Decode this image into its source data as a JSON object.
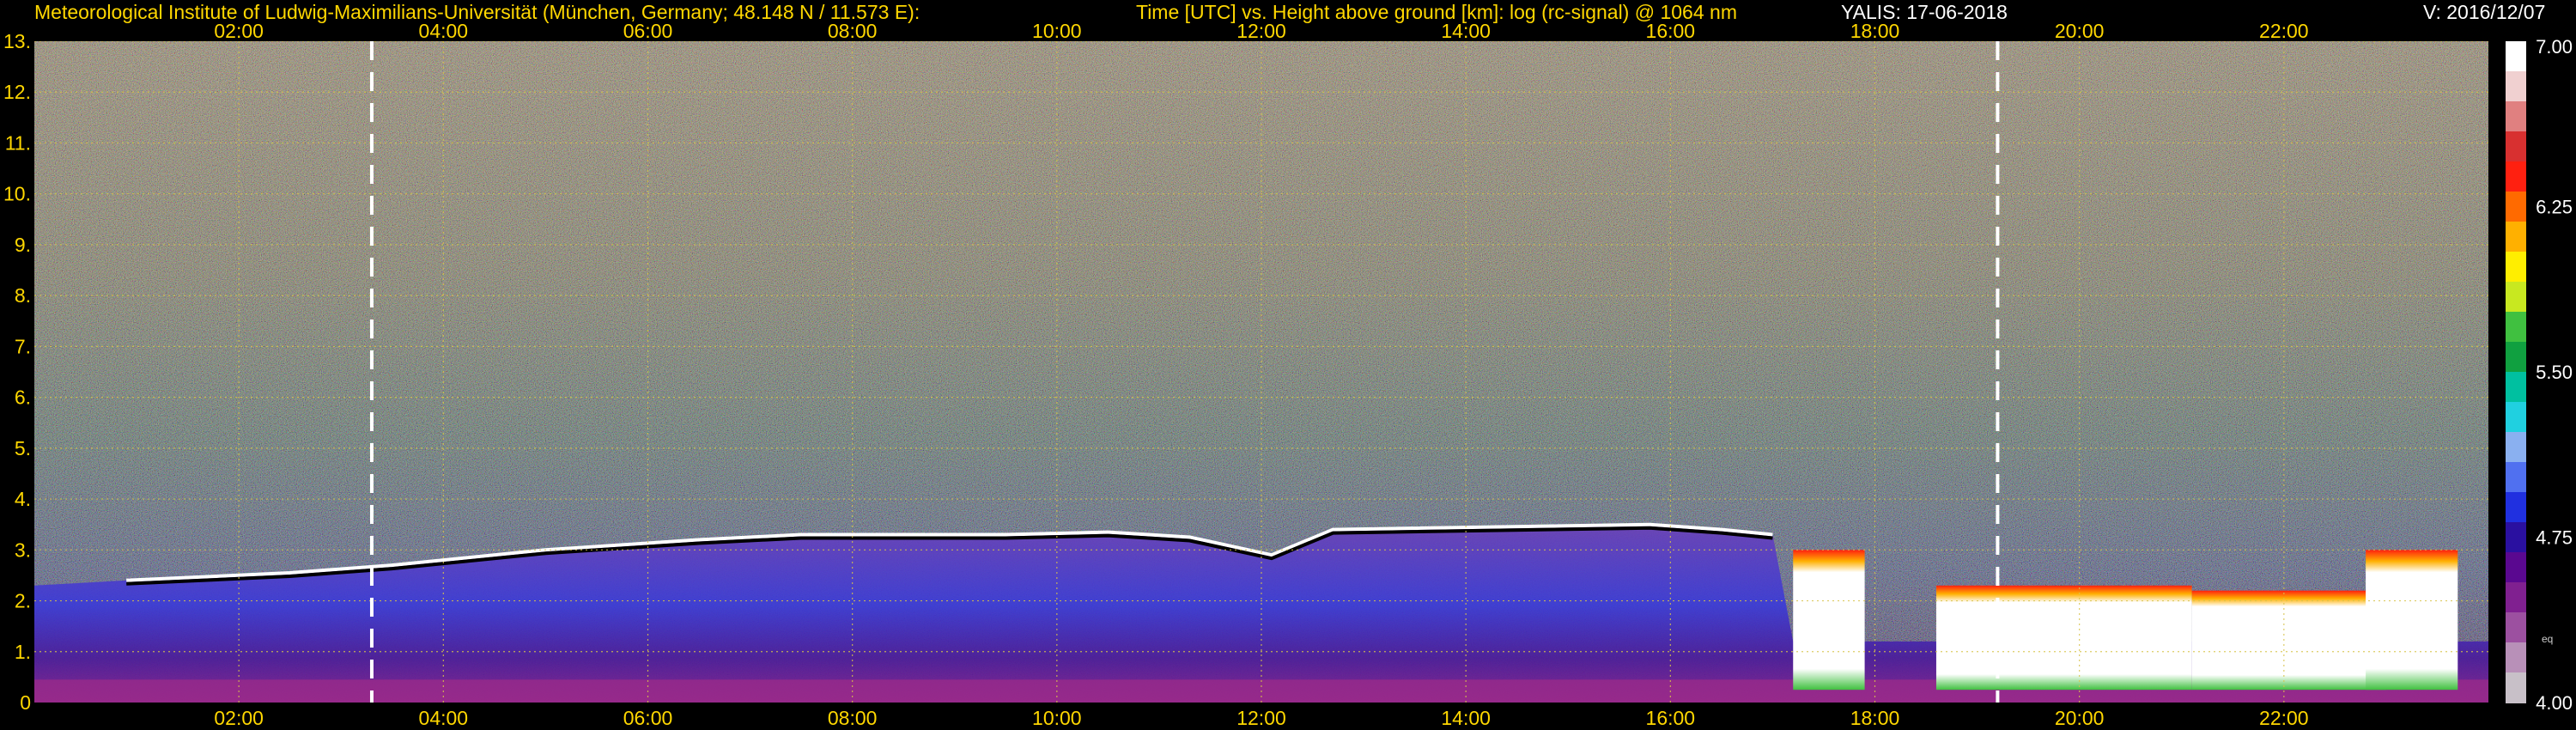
{
  "header": {
    "institute": "Meteorological Institute of Ludwig-Maximilians-Universität (München, Germany; 48.148 N / 11.573 E):",
    "axes_title": "Time [UTC] vs. Height above ground [km]: log (rc-signal) @ 1064 nm",
    "station_date": "YALIS: 17-06-2018",
    "version": "V: 2016/12/07"
  },
  "chart_data": {
    "type": "heatmap",
    "title": "Time [UTC] vs. Height above ground [km]: log (rc-signal) @ 1064 nm",
    "xlabel": "Time [UTC]",
    "ylabel": "Height above ground [km]",
    "x_tick_labels": [
      "02:00",
      "04:00",
      "06:00",
      "08:00",
      "10:00",
      "12:00",
      "14:00",
      "16:00",
      "18:00",
      "20:00",
      "22:00"
    ],
    "x_ticks_hours": [
      2,
      4,
      6,
      8,
      10,
      12,
      14,
      16,
      18,
      20,
      22
    ],
    "xlim_hours": [
      0.0,
      24.0
    ],
    "y_tick_labels": [
      "0",
      "1.",
      "2.",
      "3.",
      "4.",
      "5.",
      "6.",
      "7.",
      "8.",
      "9.",
      "10.",
      "11.",
      "12.",
      "13."
    ],
    "y_ticks_km": [
      0,
      1,
      2,
      3,
      4,
      5,
      6,
      7,
      8,
      9,
      10,
      11,
      12,
      13
    ],
    "ylim_km": [
      0,
      13
    ],
    "grid": true,
    "dashed_markers_hours": [
      3.3,
      19.2
    ],
    "colorbar": {
      "range": [
        4.0,
        7.0
      ],
      "tick_labels": [
        "7.00",
        "6.25",
        "5.50",
        "4.75",
        "4.00"
      ],
      "tick_values": [
        7.0,
        6.25,
        5.5,
        4.75,
        4.0
      ],
      "small_label": "eq",
      "colors": [
        "#ffffff",
        "#f0d0d0",
        "#e08080",
        "#d83030",
        "#ff2010",
        "#ff6a00",
        "#ffb000",
        "#ffee00",
        "#c8e820",
        "#40c040",
        "#10a040",
        "#00c0a0",
        "#20d0e0",
        "#8ab0f0",
        "#5070f0",
        "#2030e0",
        "#2a10a0",
        "#5a0890",
        "#802090",
        "#9c50a0",
        "#b890b8",
        "#c8c0c8"
      ]
    },
    "boundary_layer_top_km": [
      {
        "t": 0.9,
        "h": 2.4
      },
      {
        "t": 2.5,
        "h": 2.55
      },
      {
        "t": 3.5,
        "h": 2.7
      },
      {
        "t": 5.0,
        "h": 3.0
      },
      {
        "t": 6.5,
        "h": 3.2
      },
      {
        "t": 7.5,
        "h": 3.3
      },
      {
        "t": 8.1,
        "h": 3.3
      },
      {
        "t": 9.5,
        "h": 3.3
      },
      {
        "t": 10.5,
        "h": 3.35
      },
      {
        "t": 11.3,
        "h": 3.25
      },
      {
        "t": 12.1,
        "h": 2.9
      },
      {
        "t": 12.7,
        "h": 3.4
      },
      {
        "t": 15.8,
        "h": 3.5
      },
      {
        "t": 16.5,
        "h": 3.4
      },
      {
        "t": 17.0,
        "h": 3.3
      }
    ],
    "low_cloud_events": [
      {
        "t0": 17.2,
        "t1": 17.9,
        "top_km": 3.0
      },
      {
        "t0": 18.6,
        "t1": 21.1,
        "top_km": 2.3
      },
      {
        "t0": 21.1,
        "t1": 23.0,
        "top_km": 2.2
      },
      {
        "t0": 22.8,
        "t1": 23.7,
        "top_km": 3.0
      }
    ]
  }
}
